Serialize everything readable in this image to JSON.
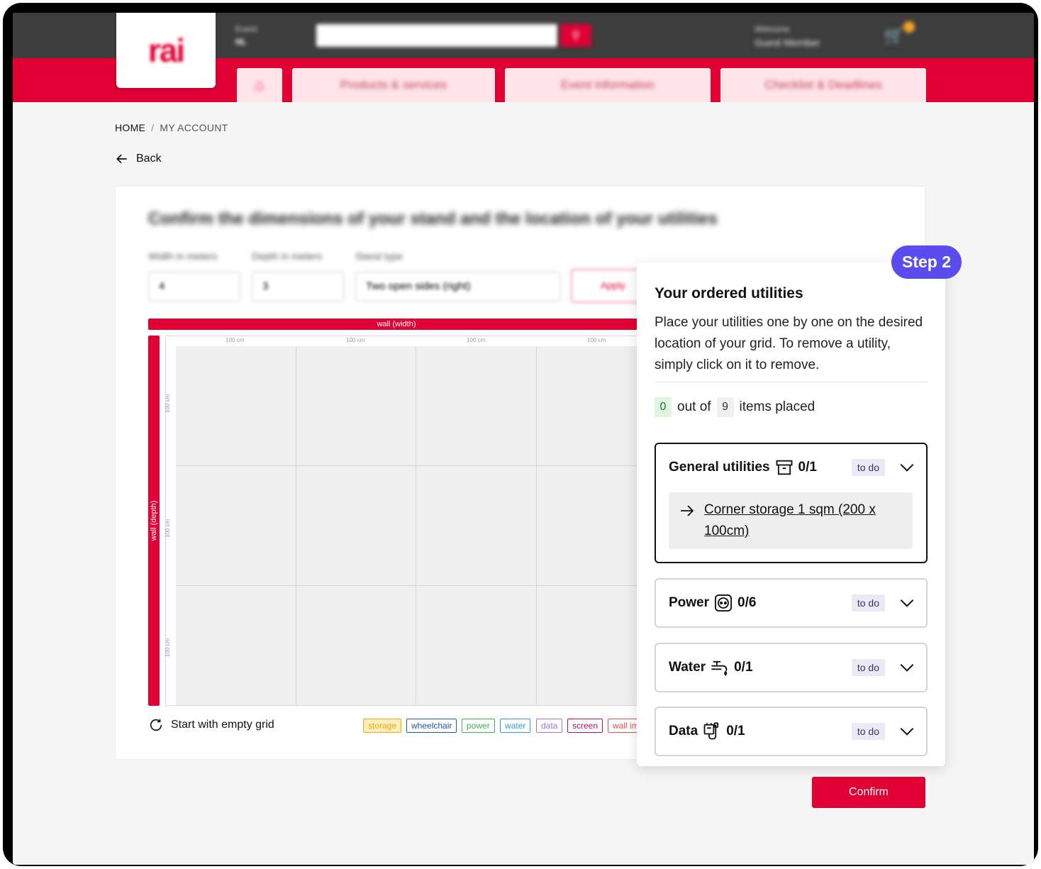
{
  "header": {
    "logo_text": "rai",
    "nav_tabs": [
      "Products & services",
      "Event information",
      "Checklist & Deadlines"
    ]
  },
  "breadcrumb": {
    "home": "HOME",
    "current": "MY ACCOUNT"
  },
  "back_label": "Back",
  "stand": {
    "title": "Confirm the dimensions of your stand and the location of your utilities",
    "width_label": "Width in meters",
    "depth_label": "Depth in meters",
    "type_label": "Stand type",
    "width_value": "4",
    "depth_value": "3",
    "type_value": "Two open sides (right)",
    "apply_label": "Apply",
    "wall_width_label": "wall (width)",
    "wall_depth_label": "wall (depth)",
    "col_ticks": [
      "100 cm",
      "100 cm",
      "100 cm",
      "100 cm"
    ],
    "row_ticks": [
      "100 cm",
      "100 cm",
      "100 cm"
    ],
    "restart_label": "Start with empty grid",
    "legend": [
      {
        "label": "storage",
        "color": "#e8a90c",
        "bg": "#fdeebd"
      },
      {
        "label": "wheelchair",
        "color": "#1f55a8",
        "bg": "#ffffff"
      },
      {
        "label": "power",
        "color": "#39b54a",
        "bg": "#ffffff"
      },
      {
        "label": "water",
        "color": "#2f9ad6",
        "bg": "#ffffff"
      },
      {
        "label": "data",
        "color": "#9a73d6",
        "bg": "#ffffff"
      },
      {
        "label": "screen",
        "color": "#b0106a",
        "bg": "#ffffff"
      },
      {
        "label": "wall im",
        "color": "#e05050",
        "bg": "#ffffff"
      }
    ]
  },
  "step_badge": "Step 2",
  "utilities": {
    "title": "Your ordered utilities",
    "description": "Place your utilities one by one on the desired location of your grid. To remove a utility, simply click on it to remove.",
    "placed": "0",
    "out_of": "out of",
    "total": "9",
    "items_placed": "items placed",
    "groups": [
      {
        "name": "General utilities",
        "icon": "archive-box-icon",
        "count": "0/1",
        "status": "to do",
        "open": true,
        "items": [
          "Corner storage 1 sqm (200 x 100cm)"
        ]
      },
      {
        "name": "Power",
        "icon": "power-socket-icon",
        "count": "0/6",
        "status": "to do",
        "open": false
      },
      {
        "name": "Water",
        "icon": "water-tap-icon",
        "count": "0/1",
        "status": "to do",
        "open": false
      },
      {
        "name": "Data",
        "icon": "network-plug-icon",
        "count": "0/1",
        "status": "to do",
        "open": false
      }
    ]
  },
  "confirm_label": "Confirm"
}
